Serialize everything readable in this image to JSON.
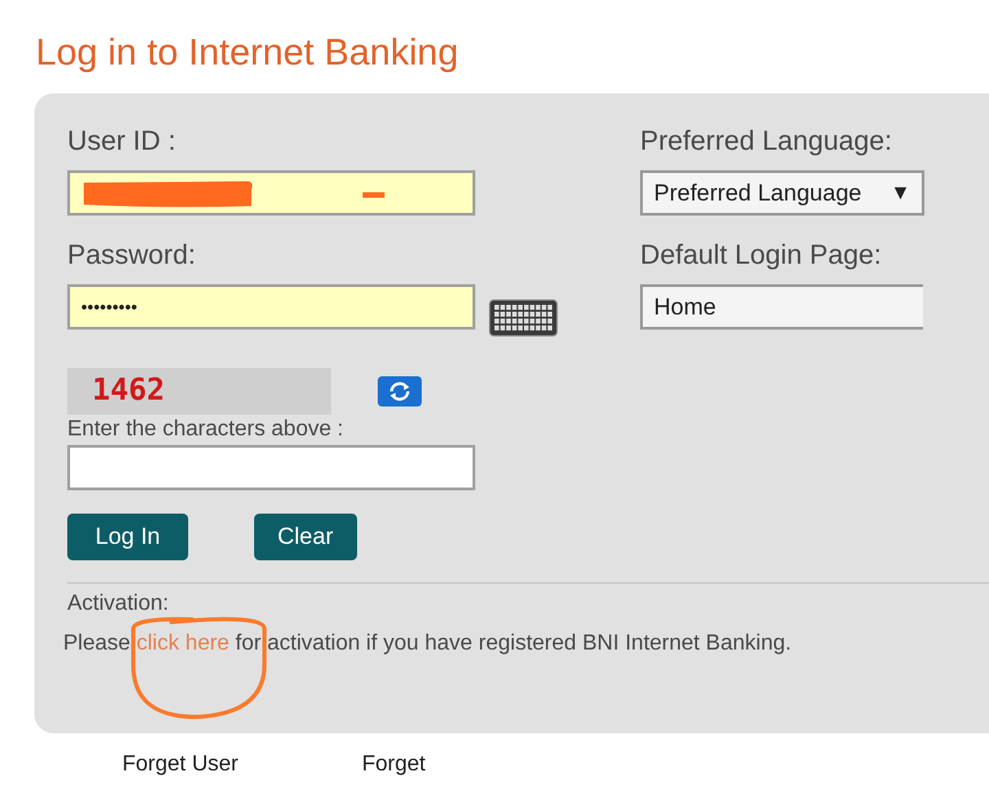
{
  "title": "Log in to Internet Banking",
  "user_id": {
    "label": "User ID :",
    "redacted": true
  },
  "password": {
    "label": "Password:",
    "value": "•••••••••"
  },
  "captcha": {
    "code": "1462",
    "prompt": "Enter the characters above :"
  },
  "language": {
    "label": "Preferred Language:",
    "value": "Preferred Language",
    "arrow": "▼"
  },
  "login_page": {
    "label": "Default Login Page:",
    "value": "Home"
  },
  "buttons": [
    "Log In",
    "Clear"
  ],
  "activation": {
    "label": "Activation:",
    "before": "Please",
    "link": "click here",
    "after": "for activation if you have registered BNI Internet Banking.",
    "circled": true
  },
  "footer_links": [
    "Forget User",
    "Forget"
  ]
}
